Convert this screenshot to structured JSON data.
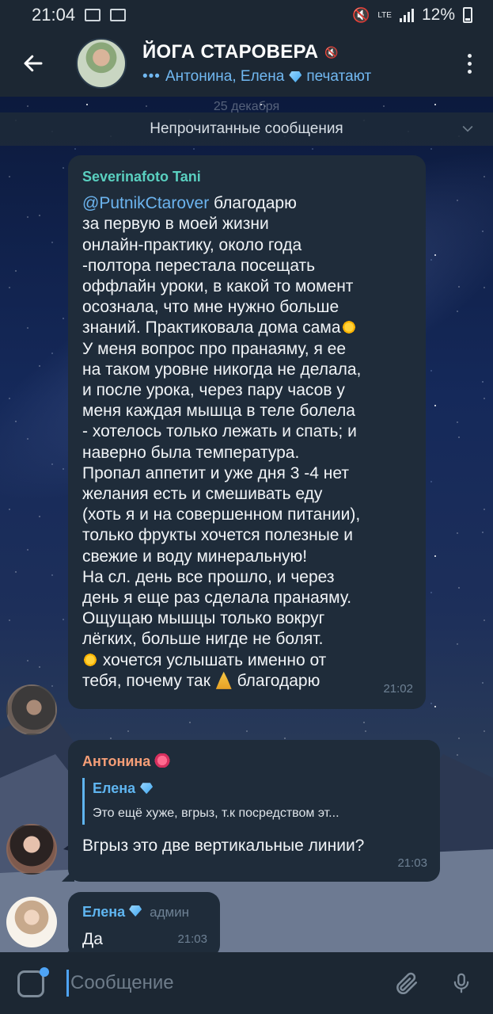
{
  "status_bar": {
    "time": "21:04",
    "network": "LTE",
    "battery": "12%"
  },
  "header": {
    "title": "ЙОГА СТАРОВЕРА",
    "typing_names": "Антонина, Елена",
    "typing_action": "печатают"
  },
  "chat": {
    "date_label": "25 декабря",
    "unread_label": "Непрочитанные сообщения",
    "messages": [
      {
        "sender": "Severinafoto Tani",
        "mention": "@PutnikCtarover",
        "lines": [
          " благодарю",
          "за первую в моей жизни",
          "онлайн-практику, около года",
          "-полтора  перестала посещать",
          "оффлайн уроки, в какой то момент",
          "осознала, что мне нужно больше",
          "знаний. Практиковала дома сама"
        ],
        "lines2": [
          "У меня вопрос про пранаяму, я ее",
          "на таком уровне никогда не делала,",
          "и после урока, через пару часов у",
          "меня каждая мышца в теле болела",
          "- хотелось только лежать и спать;  и",
          "наверно была температура.",
          "Пропал аппетит и уже дня 3 -4 нет",
          "желания есть и смешивать еду",
          "(хоть я и на совершенном питании),",
          "только фрукты хочется полезные и",
          "свежие и воду минеральную!",
          "На сл. день все прошло, и через",
          "день я еще раз сделала пранаяму.",
          "Ощущаю мышцы только вокруг",
          "лёгких,  больше нигде не болят."
        ],
        "last_part1": " хочется услышать именно от",
        "last_part2": "тебя, почему так ",
        "last_part3": " благодарю",
        "time": "21:02"
      },
      {
        "sender": "Антонина",
        "reply_name": "Елена",
        "reply_text": "Это ещё хуже, вгрыз, т.к посредством эт...",
        "text": "Вгрыз это две вертикальные линии?",
        "time": "21:03"
      },
      {
        "sender": "Елена",
        "role": "админ",
        "text": "Да",
        "time": "21:03"
      }
    ]
  },
  "input": {
    "placeholder": "Сообщение"
  },
  "colors": {
    "header_bg": "#1c2733",
    "bubble_bg": "#1f2c3a",
    "accent_blue": "#4ea4f6",
    "sender_green": "#5ad0c0",
    "sender_orange": "#f59e77",
    "sender_blue": "#5fb5f0"
  }
}
